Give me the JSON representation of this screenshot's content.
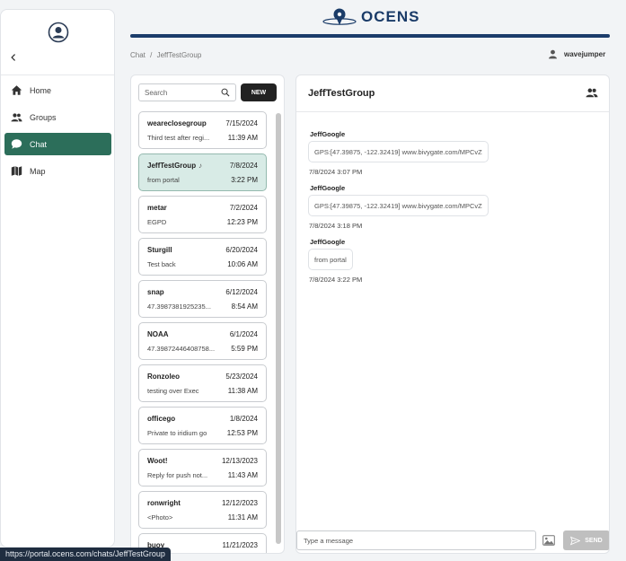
{
  "brand": {
    "name": "OCENS"
  },
  "sidebar": {
    "items": [
      {
        "label": "Home",
        "icon": "home-icon"
      },
      {
        "label": "Groups",
        "icon": "groups-icon"
      },
      {
        "label": "Chat",
        "icon": "chat-icon",
        "active": true
      },
      {
        "label": "Map",
        "icon": "map-icon"
      }
    ]
  },
  "breadcrumb": {
    "root": "Chat",
    "separator": "/",
    "current": "JeffTestGroup"
  },
  "user": {
    "name": "wavejumper"
  },
  "search": {
    "placeholder": "Search"
  },
  "new_button": "NEW",
  "chats": [
    {
      "name": "weareclosegroup",
      "date": "7/15/2024",
      "preview": "Third test after regi...",
      "time": "11:39 AM"
    },
    {
      "name": "JeffTestGroup",
      "date": "7/8/2024",
      "preview": "from portal",
      "time": "3:22 PM",
      "note": "♪",
      "selected": true
    },
    {
      "name": "metar",
      "date": "7/2/2024",
      "preview": "EGPD",
      "time": "12:23 PM"
    },
    {
      "name": "Sturgill",
      "date": "6/20/2024",
      "preview": "Test back",
      "time": "10:06 AM"
    },
    {
      "name": "snap",
      "date": "6/12/2024",
      "preview": "47.3987381925235...",
      "time": "8:54 AM"
    },
    {
      "name": "NOAA",
      "date": "6/1/2024",
      "preview": "47.39872446408758...",
      "time": "5:59 PM"
    },
    {
      "name": "Ronzoleo",
      "date": "5/23/2024",
      "preview": "testing over Exec",
      "time": "11:38 AM"
    },
    {
      "name": "officego",
      "date": "1/8/2024",
      "preview": "Private to iridium go",
      "time": "12:53 PM"
    },
    {
      "name": "Woot!",
      "date": "12/13/2023",
      "preview": "Reply for push not...",
      "time": "11:43 AM"
    },
    {
      "name": "ronwright",
      "date": "12/12/2023",
      "preview": "<Photo>",
      "time": "11:31 AM"
    },
    {
      "name": "buoy",
      "date": "11/21/2023",
      "preview": "",
      "time": ""
    }
  ],
  "conversation": {
    "title": "JeffTestGroup",
    "messages": [
      {
        "sender": "JeffGoogle",
        "text": "GPS:[47.39875, -122.32419] www.bivygate.com/MPCvZ",
        "time": "7/8/2024 3:07 PM"
      },
      {
        "sender": "JeffGoogle",
        "text": "GPS:[47.39875, -122.32419] www.bivygate.com/MPCvZ",
        "time": "7/8/2024 3:18 PM"
      },
      {
        "sender": "JeffGoogle",
        "text": "from portal",
        "time": "7/8/2024 3:22 PM"
      }
    ]
  },
  "composer": {
    "placeholder": "Type a message",
    "send_label": "SEND"
  },
  "status_url": "https://portal.ocens.com/chats/JeffTestGroup"
}
